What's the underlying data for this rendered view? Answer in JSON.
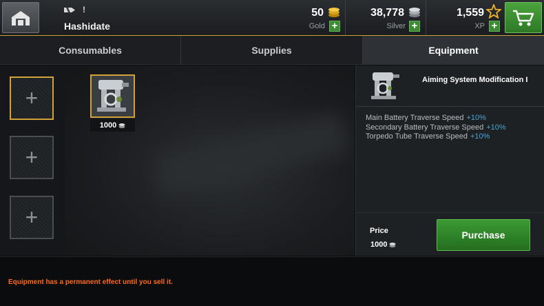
{
  "header": {
    "ship_name": "Hashidate",
    "notice_mark": "!",
    "gold": {
      "value": "50",
      "label": "Gold"
    },
    "silver": {
      "value": "38,778",
      "label": "Silver"
    },
    "xp": {
      "value": "1,559",
      "label": "XP"
    },
    "plus_label": "+"
  },
  "tabs": [
    {
      "label": "Consumables"
    },
    {
      "label": "Supplies"
    },
    {
      "label": "Equipment",
      "active": true
    }
  ],
  "slots": {
    "add_symbol": "+",
    "count": 3
  },
  "shop_item": {
    "price": "1000"
  },
  "details": {
    "name": "Aiming System Modification I",
    "stats": [
      {
        "label": "Main Battery Traverse Speed",
        "bonus": "+10%"
      },
      {
        "label": "Secondary Battery Traverse Speed",
        "bonus": "+10%"
      },
      {
        "label": "Torpedo Tube Traverse Speed",
        "bonus": "+10%"
      }
    ],
    "price_label": "Price",
    "price_value": "1000",
    "purchase_label": "Purchase"
  },
  "footer": {
    "message": "Equipment has a permanent effect until you sell it."
  },
  "colors": {
    "accent_gold": "#d2a33b",
    "purchase_green": "#2e8a28",
    "bonus_blue": "#4aa3d6",
    "warning_orange": "#ff6a1a"
  }
}
